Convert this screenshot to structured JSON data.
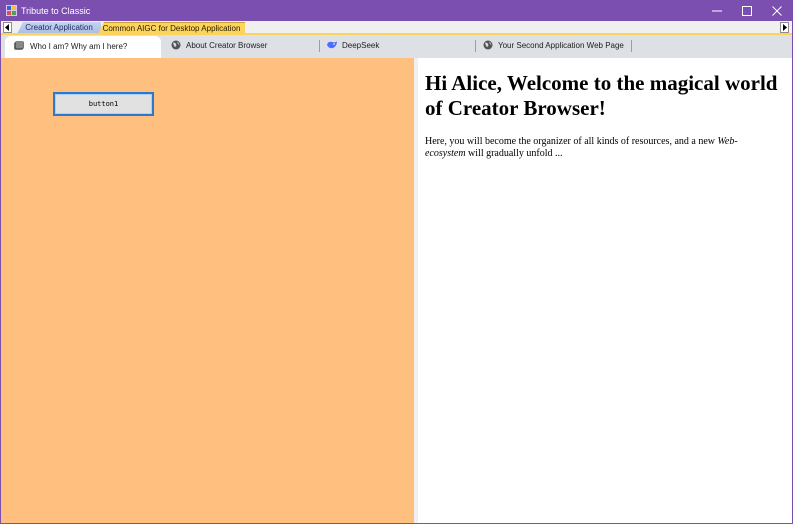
{
  "window": {
    "title": "Tribute to Classic",
    "title_bar_color": "#7a4fb0",
    "buttons": [
      "minimize",
      "maximize",
      "close"
    ]
  },
  "top_tabs": [
    {
      "label": "Creator Application",
      "color": "#a9bde6"
    },
    {
      "label": "Common AIGC for Desktop Application",
      "color": "#fcd35c",
      "active": true
    }
  ],
  "browser_tabs": [
    {
      "label": "Who I am? Why am I here?",
      "icon": "page-icon",
      "active": true
    },
    {
      "label": "About Creator Browser",
      "icon": "globe-icon"
    },
    {
      "label": "DeepSeek",
      "icon": "deepseek-icon"
    },
    {
      "label": "Your Second Application Web Page",
      "icon": "globe-icon"
    }
  ],
  "left_pane": {
    "background": "#ffbf7f",
    "button_label": "button1"
  },
  "right_pane": {
    "heading": "Hi Alice, Welcome to the magical world of Creator Browser!",
    "paragraph_before": "Here, you will become the organizer of all kinds of resources, and a new ",
    "paragraph_emphasis": "Web-ecosystem",
    "paragraph_after": " will gradually unfold ..."
  }
}
